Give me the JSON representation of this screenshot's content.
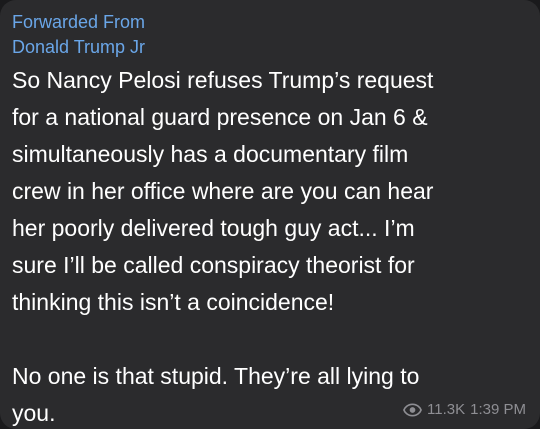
{
  "forward": {
    "label": "Forwarded From",
    "source": "Donald Trump Jr"
  },
  "message": {
    "lines": [
      "So Nancy Pelosi refuses Trump’s request",
      "for a national guard presence on Jan 6 &",
      "simultaneously has a documentary film",
      "crew in her office where are you can hear",
      "her poorly delivered tough guy act... I’m",
      "sure I’ll be called conspiracy theorist for",
      "thinking this isn’t a coincidence!",
      "",
      "No one is that stupid. They’re all lying to",
      "you."
    ]
  },
  "meta": {
    "icon": "eye-icon",
    "views": "11.3K",
    "time": "1:39 PM"
  },
  "colors": {
    "bubble": "#2b2b2d",
    "link": "#6aa6e8",
    "meta": "#8e8e93",
    "text": "#ffffff"
  }
}
